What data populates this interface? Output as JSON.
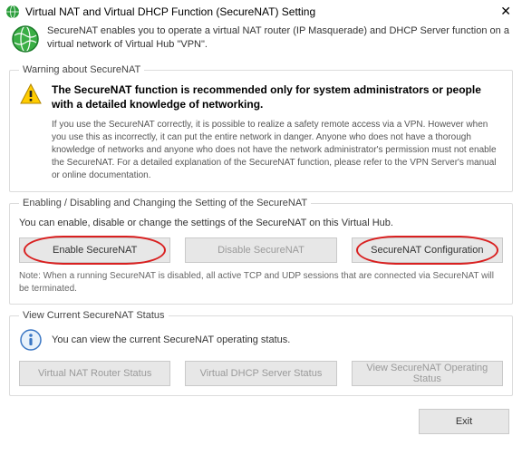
{
  "window": {
    "title": "Virtual NAT and Virtual DHCP Function (SecureNAT) Setting"
  },
  "header": {
    "description": "SecureNAT enables you to operate a virtual NAT router (IP Masquerade) and DHCP Server function on a virtual network of Virtual Hub \"VPN\"."
  },
  "warning": {
    "legend": "Warning about SecureNAT",
    "bold": "The SecureNAT function is recommended only for system administrators or people with a detailed knowledge of networking.",
    "detail": "If you use the SecureNAT correctly, it is possible to realize a safety remote access via a VPN. However when you use this as incorrectly, it can put the entire network in danger. Anyone who does not have a thorough knowledge of networks and anyone who does not have the network administrator's permission must not enable the SecureNAT. For a detailed explanation of the SecureNAT function, please refer to the VPN Server's manual or online documentation."
  },
  "enabling": {
    "legend": "Enabling / Disabling and Changing the Setting of the SecureNAT",
    "desc": "You can enable, disable or change the settings of the SecureNAT on this Virtual Hub.",
    "buttons": {
      "enable": "Enable SecureNAT",
      "disable": "Disable SecureNAT",
      "config": "SecureNAT Configuration"
    },
    "note": "Note: When a running SecureNAT is disabled, all active TCP and UDP sessions that are connected via SecureNAT will be terminated."
  },
  "status": {
    "legend": "View Current SecureNAT Status",
    "desc": "You can view the current SecureNAT operating status.",
    "buttons": {
      "nat": "Virtual NAT Router Status",
      "dhcp": "Virtual DHCP Server Status",
      "view": "View SecureNAT Operating Status"
    }
  },
  "footer": {
    "exit": "Exit"
  }
}
